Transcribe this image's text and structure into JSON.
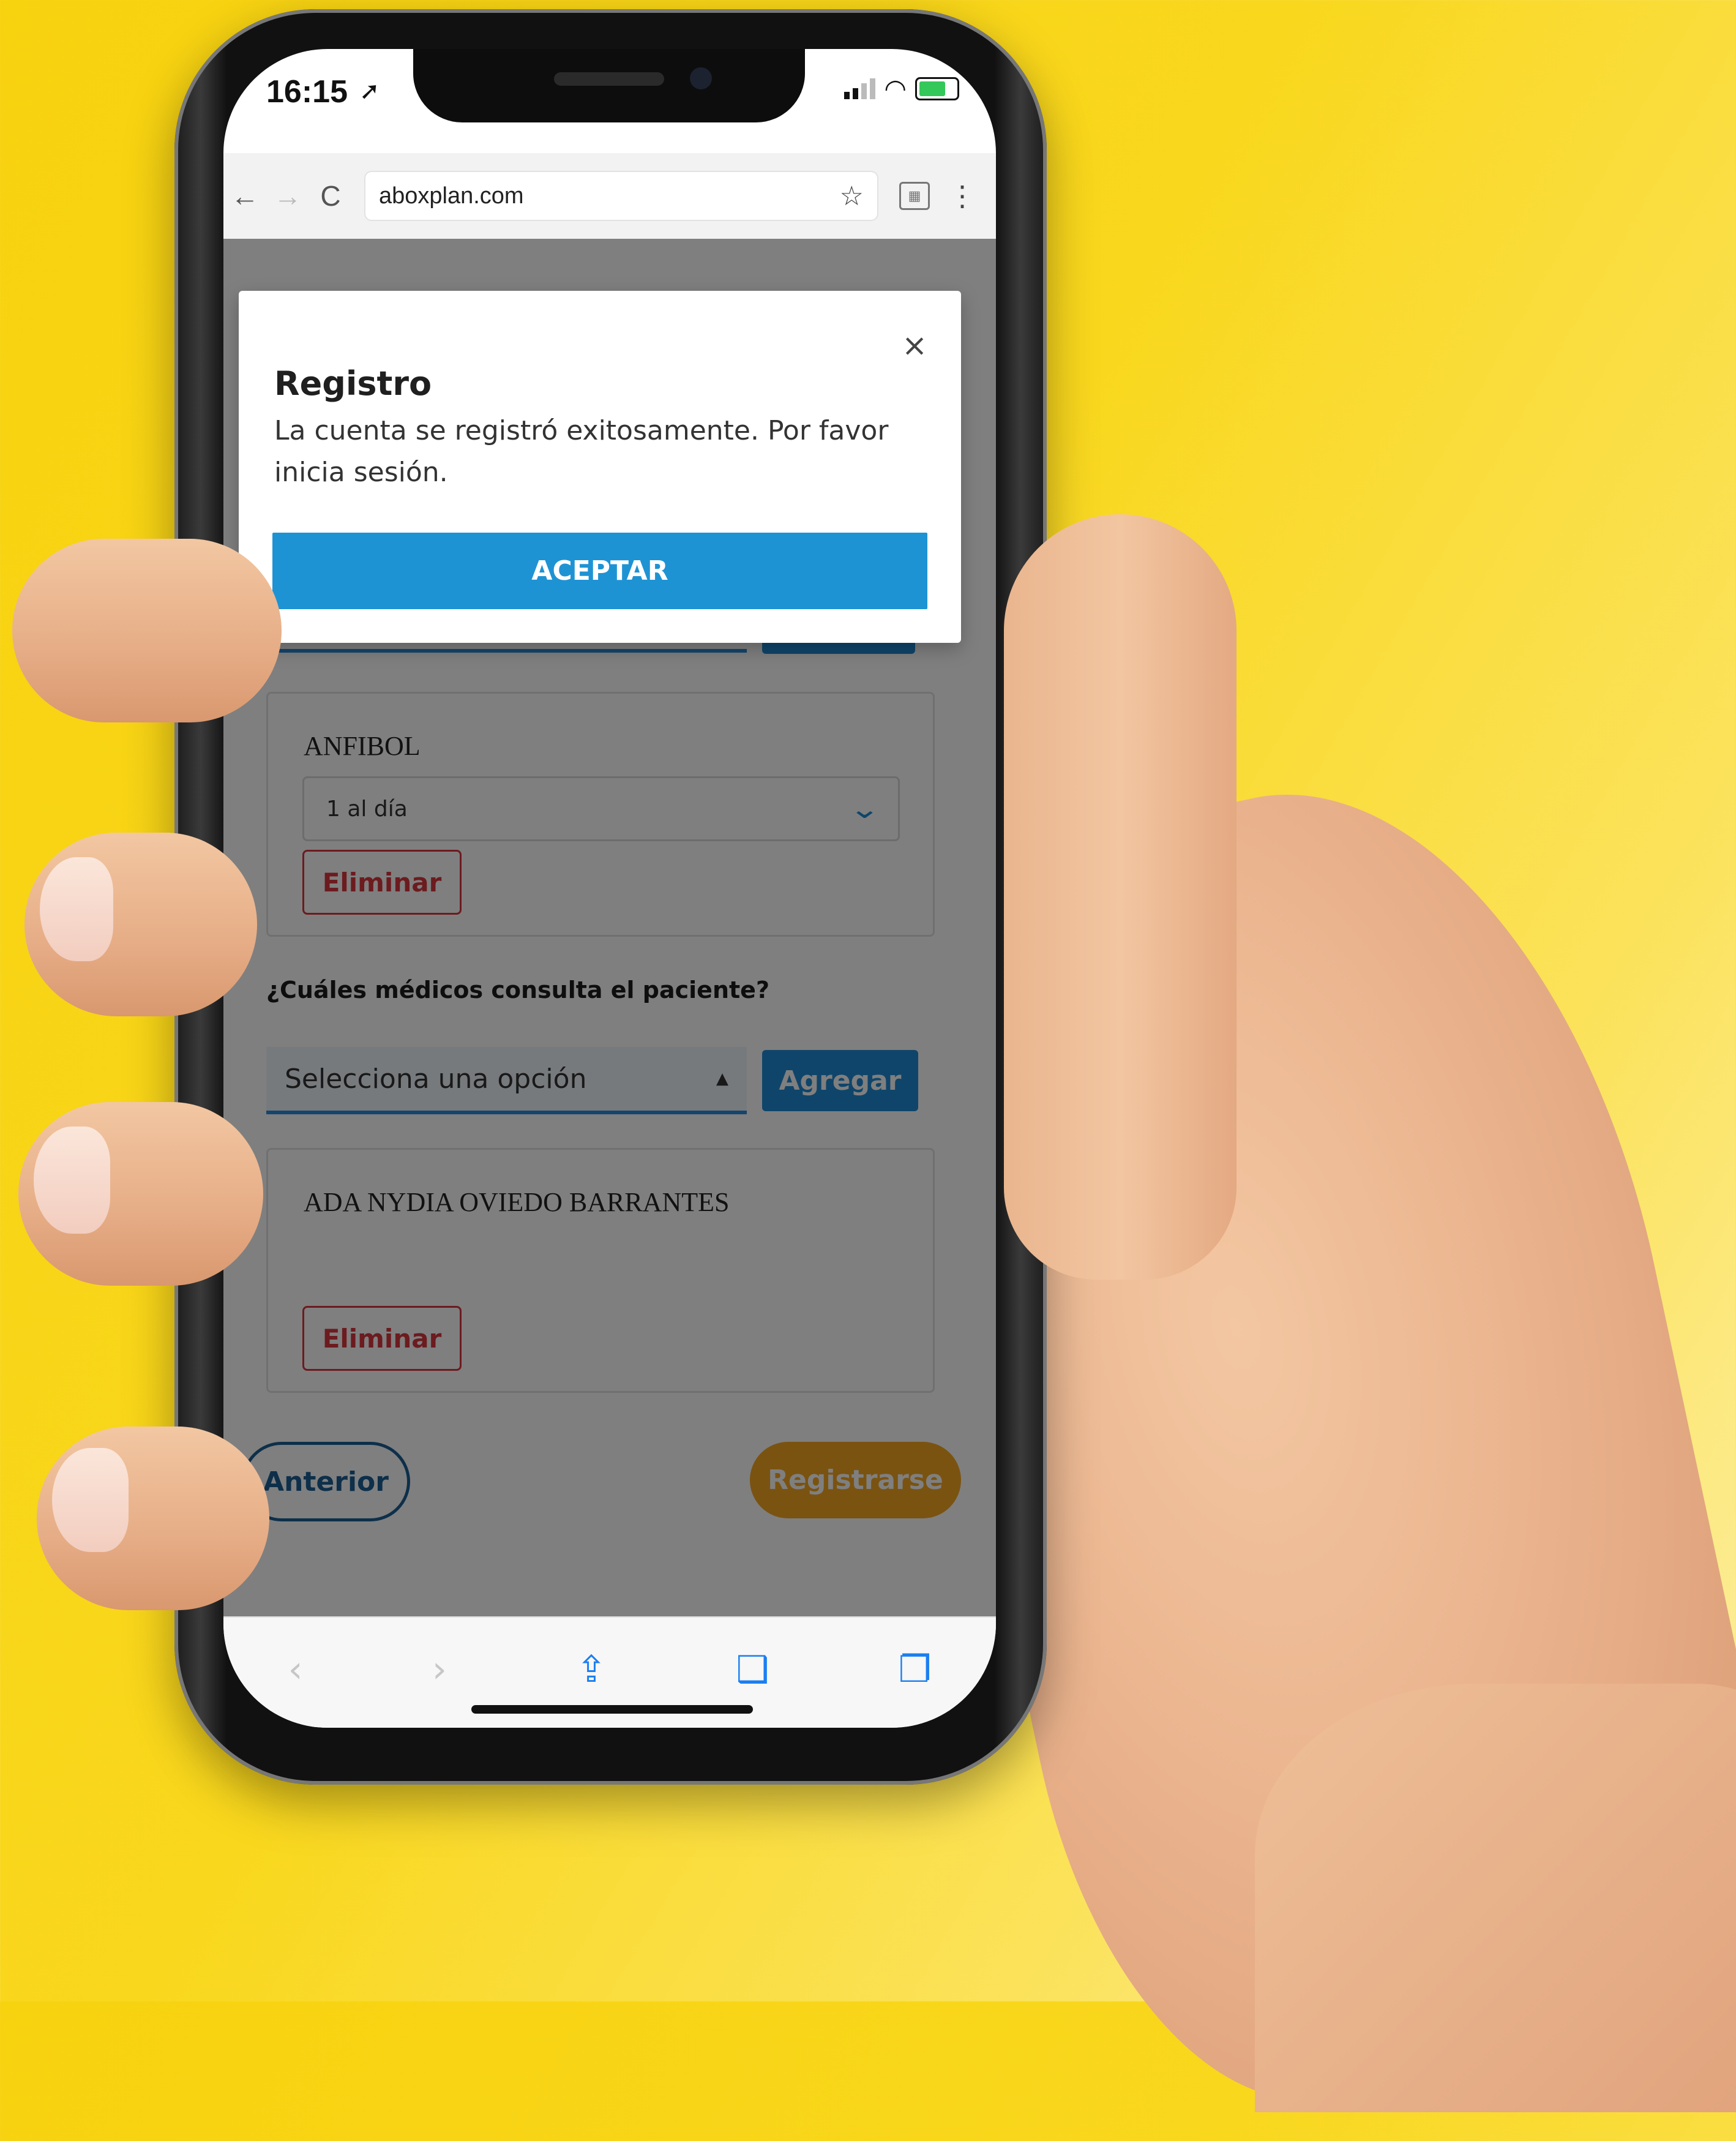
{
  "status_bar": {
    "time": "16:15",
    "location_icon": "location-arrow-icon",
    "signal_icon": "signal-icon",
    "wifi_icon": "wifi-icon",
    "battery_icon": "battery-charging-icon"
  },
  "browser": {
    "url": "aboxplan.com",
    "back_icon": "←",
    "forward_icon": "→",
    "reload_icon": "C",
    "bookmark_icon": "☆",
    "menu_icon": "⋮"
  },
  "page": {
    "medication_card": {
      "title": "ANFIBOL",
      "frequency_value": "1 al día",
      "remove_label": "Eliminar"
    },
    "doctors_question": "¿Cuáles médicos consulta el paciente?",
    "doctor_select": {
      "placeholder": "Selecciona una opción",
      "add_label": "Agregar"
    },
    "doctor_card": {
      "title": "ADA NYDIA OVIEDO BARRANTES",
      "remove_label": "Eliminar"
    },
    "previous_label": "Anterior",
    "register_label": "Registrarse"
  },
  "modal": {
    "title": "Registro",
    "message": "La cuenta se registró exitosamente. Por favor inicia sesión.",
    "accept_label": "ACEPTAR",
    "close_icon": "×"
  },
  "colors": {
    "background_yellow": "#f7d20f",
    "primary_blue": "#1e93d4",
    "danger_red": "#d9363e",
    "orange": "#f5a623",
    "dark_blue": "#1b5f95"
  }
}
